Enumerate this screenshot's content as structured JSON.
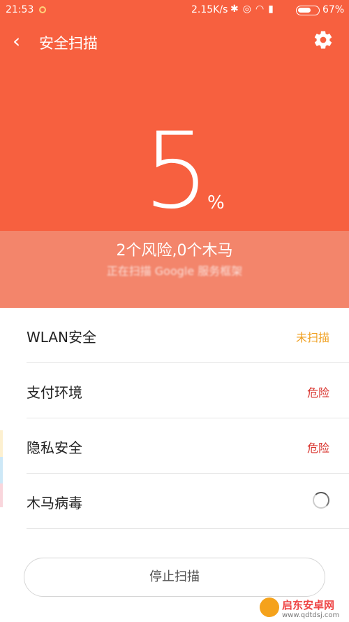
{
  "status_bar": {
    "time": "21:53",
    "speed": "2.15K/s",
    "battery_percent": "67%",
    "battery_level": 0.67
  },
  "header": {
    "title": "安全扫描"
  },
  "progress": {
    "value": "5",
    "unit": "%"
  },
  "scan": {
    "summary": "2个风险,0个木马",
    "current_item": "正在扫描 Google 服务框架"
  },
  "items": [
    {
      "label": "WLAN安全",
      "status": "未扫描",
      "state": "pending"
    },
    {
      "label": "支付环境",
      "status": "危险",
      "state": "danger"
    },
    {
      "label": "隐私安全",
      "status": "危险",
      "state": "danger"
    },
    {
      "label": "木马病毒",
      "status": "",
      "state": "scanning"
    }
  ],
  "footer": {
    "stop_label": "停止扫描"
  },
  "watermark": {
    "title": "启东安卓网",
    "url": "www.qdtdsj.com"
  },
  "colors": {
    "primary": "#f7603f",
    "band": "#f3856b",
    "pending": "#f0a020",
    "danger": "#d8302a"
  }
}
